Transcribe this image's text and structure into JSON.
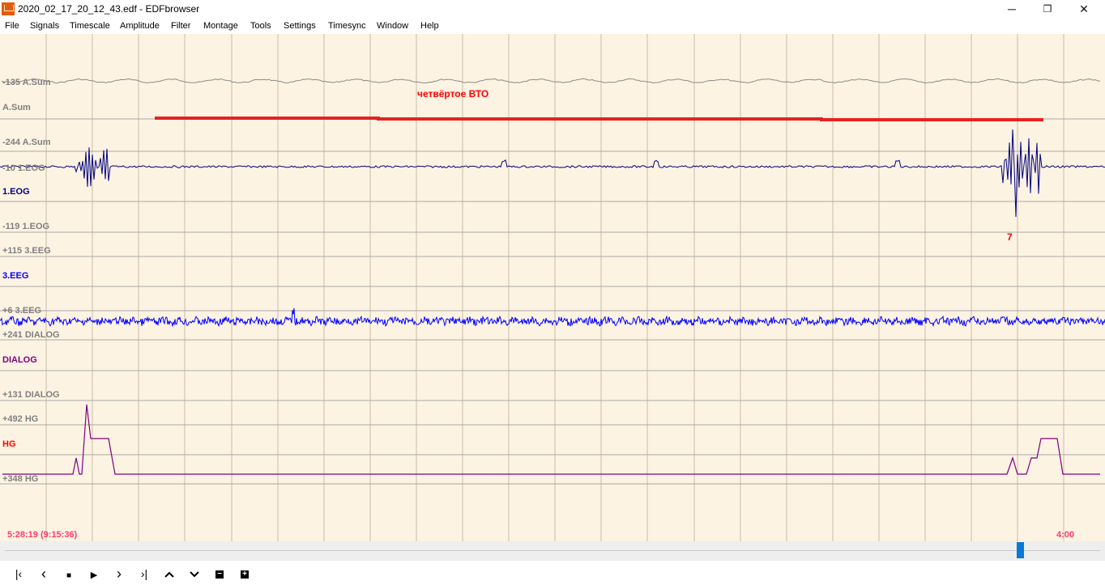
{
  "window": {
    "title": "2020_02_17_20_12_43.edf - EDFbrowser",
    "icon": "edfbrowser-app-icon",
    "controls": [
      "minimize",
      "maximize",
      "close"
    ]
  },
  "menu": [
    "File",
    "Signals",
    "Timescale",
    "Amplitude",
    "Filter",
    "Montage",
    "Tools",
    "Settings",
    "Timesync",
    "Window",
    "Help"
  ],
  "colors": {
    "background": "#fdf3e2",
    "grid": "#c9bea6",
    "baseline": "#a9a9a9",
    "label": "#808080",
    "eog": "#000080",
    "eeg": "#0000ff",
    "dialog": "#800080",
    "hg": "#800080",
    "annotation": "#ff0000",
    "time": "#ff3a6b",
    "accent": "#0a78d7"
  },
  "signals": [
    {
      "id": "asum",
      "top_label": "-135 A.Sum",
      "name": "A.Sum",
      "bottom_label": "-244 A.Sum",
      "name_color": "#808080"
    },
    {
      "id": "eog",
      "top_label": "-10 1.EOG",
      "name": "1.EOG",
      "bottom_label": "-119 1.EOG",
      "name_color": "#000080"
    },
    {
      "id": "eeg",
      "top_label": "+115 3.EEG",
      "name": "3.EEG",
      "bottom_label": "+6 3.EEG",
      "name_color": "#0000ff"
    },
    {
      "id": "dialog",
      "top_label": "+241 DIALOG",
      "name": "DIALOG",
      "bottom_label": "+131 DIALOG",
      "name_color": "#800080"
    },
    {
      "id": "hg",
      "top_label": "+492 HG",
      "name": "HG",
      "bottom_label": "+348 HG",
      "name_color": "#ff0000"
    }
  ],
  "annotations": {
    "label": "четвёртое ВТО",
    "event_marker": "7"
  },
  "time": {
    "start": "5:28:19 (9:15:36)",
    "end": "4:00"
  },
  "scrollbar": {
    "position_fraction": 0.93
  },
  "toolbar": [
    {
      "name": "first-page-button",
      "glyph": "⏮",
      "icon": "skip-to-start-icon"
    },
    {
      "name": "previous-page-button",
      "glyph": "‹",
      "icon": "chevron-left-icon"
    },
    {
      "name": "stop-button",
      "glyph": "■",
      "icon": "stop-icon"
    },
    {
      "name": "play-button",
      "glyph": "▶",
      "icon": "play-icon"
    },
    {
      "name": "next-page-button",
      "glyph": "›",
      "icon": "chevron-right-icon"
    },
    {
      "name": "last-page-button",
      "glyph": "⏭",
      "icon": "skip-to-end-icon"
    },
    {
      "name": "scroll-up-button",
      "glyph": "⌃",
      "icon": "chevron-up-icon"
    },
    {
      "name": "scroll-down-button",
      "glyph": "⌄",
      "icon": "chevron-down-icon"
    },
    {
      "name": "zoom-out-button",
      "glyph": "−",
      "icon": "minus-box-icon"
    },
    {
      "name": "zoom-in-button",
      "glyph": "+",
      "icon": "plus-box-icon"
    }
  ]
}
